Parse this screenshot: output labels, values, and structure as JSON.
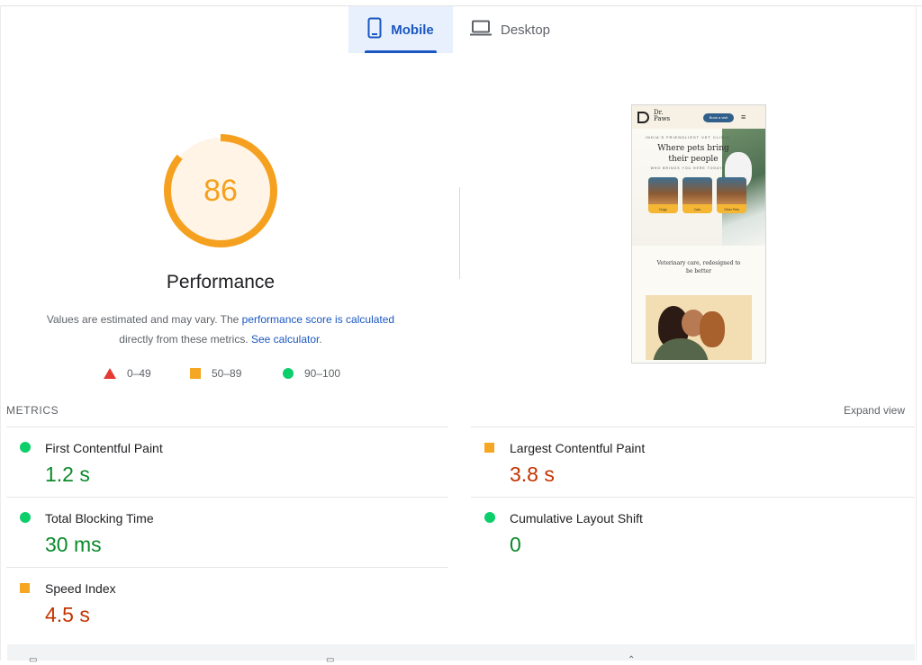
{
  "tabs": {
    "mobile": {
      "label": "Mobile",
      "icon": "smartphone-icon",
      "active": true
    },
    "desktop": {
      "label": "Desktop",
      "icon": "laptop-icon",
      "active": false
    }
  },
  "score": {
    "value": "86",
    "fraction": 0.86,
    "color": "#f5a11f",
    "title": "Performance",
    "note_text1": "Values are estimated and may vary. The ",
    "note_link1": "performance score is calculated",
    "note_text2": "directly from these metrics. ",
    "note_link2": "See calculator",
    "note_text3": "."
  },
  "legend": [
    {
      "shape": "triangle",
      "label": "0–49",
      "color": "#e53935"
    },
    {
      "shape": "square",
      "label": "50–89",
      "color": "#f5a623"
    },
    {
      "shape": "circle",
      "label": "90–100",
      "color": "#0cce6b"
    }
  ],
  "preview": {
    "logo_line1": "Dr.",
    "logo_line2": "Paws",
    "book_button": "Book a visit",
    "eyebrow": "INDIA'S FRIENDLIEST VET CLINIC",
    "headline_line1": "Where pets bring",
    "headline_line2": "their people",
    "subline": "WHO BRINGS YOU HERE TODAY?",
    "cards": [
      "Dogs",
      "Cats",
      "Other Pets"
    ],
    "tagline_line1": "Veterinary care, redesigned to",
    "tagline_line2": "be better"
  },
  "metrics": {
    "title": "METRICS",
    "expand_label": "Expand view",
    "items": [
      {
        "name": "First Contentful Paint",
        "value": "1.2 s",
        "status": "good"
      },
      {
        "name": "Largest Contentful Paint",
        "value": "3.8 s",
        "status": "average"
      },
      {
        "name": "Total Blocking Time",
        "value": "30 ms",
        "status": "good"
      },
      {
        "name": "Cumulative Layout Shift",
        "value": "0",
        "status": "good"
      },
      {
        "name": "Speed Index",
        "value": "4.5 s",
        "status": "average"
      }
    ]
  },
  "colors": {
    "accent_blue": "#1a57c0",
    "good": "#0cce6b",
    "average": "#f5a623",
    "good_text": "#0a8a2a",
    "average_text": "#c33300"
  }
}
